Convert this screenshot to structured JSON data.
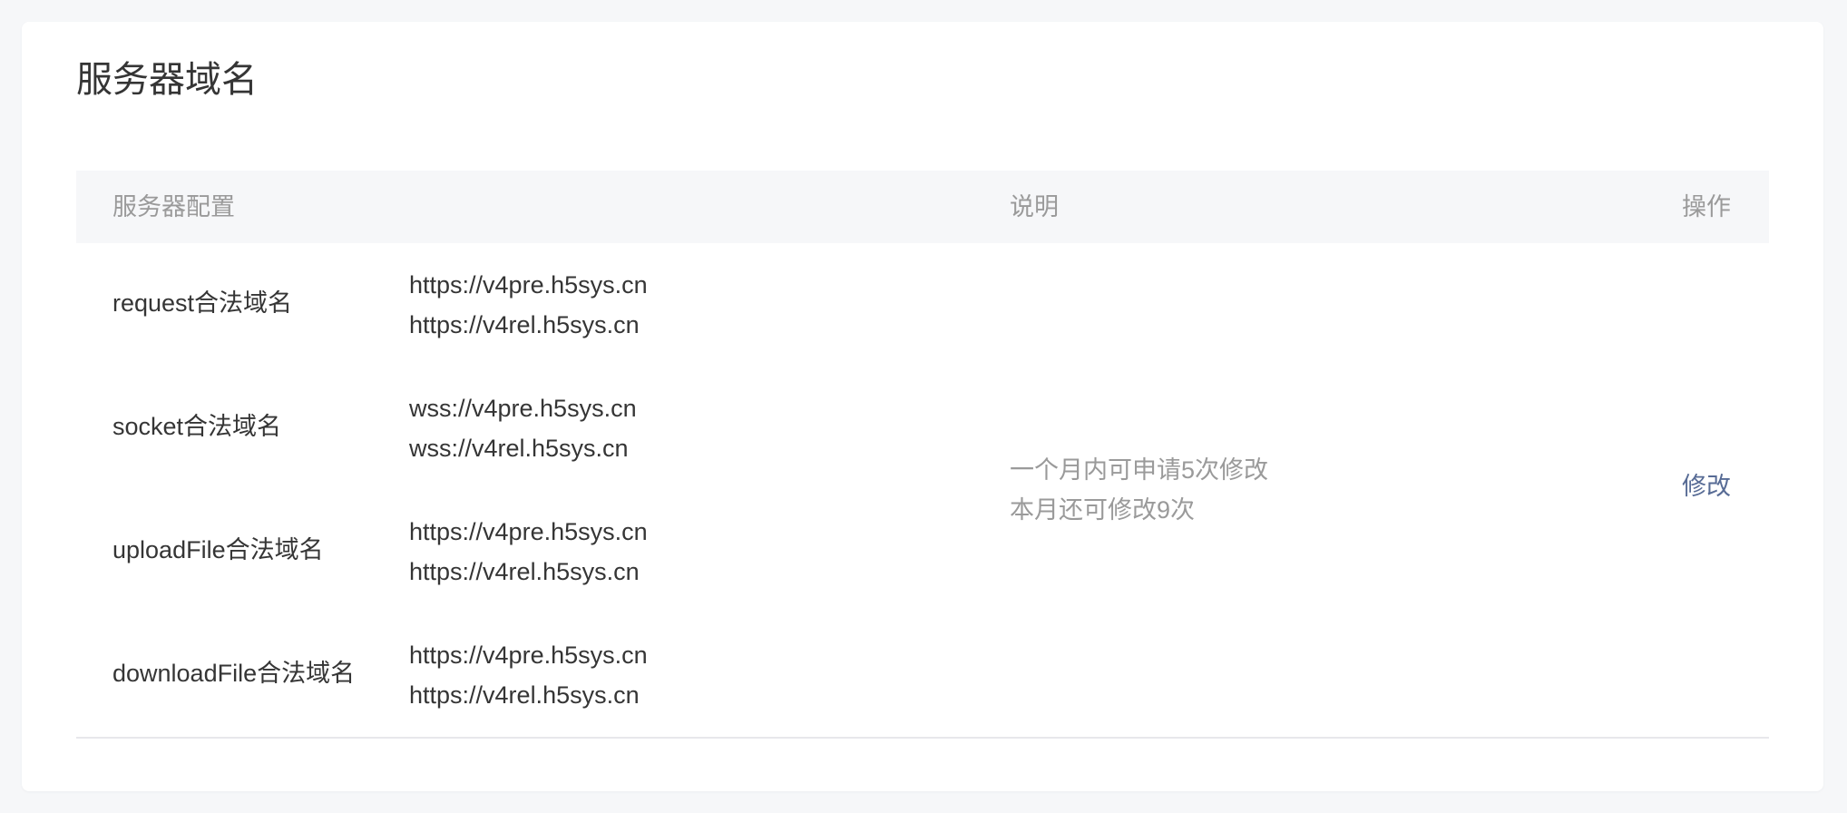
{
  "page": {
    "title": "服务器域名"
  },
  "table": {
    "headers": {
      "config": "服务器配置",
      "description": "说明",
      "operation": "操作"
    },
    "rows": [
      {
        "label": "request合法域名",
        "urls": [
          "https://v4pre.h5sys.cn",
          "https://v4rel.h5sys.cn"
        ]
      },
      {
        "label": "socket合法域名",
        "urls": [
          "wss://v4pre.h5sys.cn",
          "wss://v4rel.h5sys.cn"
        ]
      },
      {
        "label": "uploadFile合法域名",
        "urls": [
          "https://v4pre.h5sys.cn",
          "https://v4rel.h5sys.cn"
        ]
      },
      {
        "label": "downloadFile合法域名",
        "urls": [
          "https://v4pre.h5sys.cn",
          "https://v4rel.h5sys.cn"
        ]
      }
    ],
    "description": {
      "line1": "一个月内可申请5次修改",
      "line2": "本月还可修改9次"
    },
    "operation": {
      "modify_label": "修改"
    }
  },
  "colors": {
    "link": "#576b95",
    "muted_text": "#9a9a9a",
    "primary_text": "#353535",
    "header_bg": "#f6f7f9"
  }
}
